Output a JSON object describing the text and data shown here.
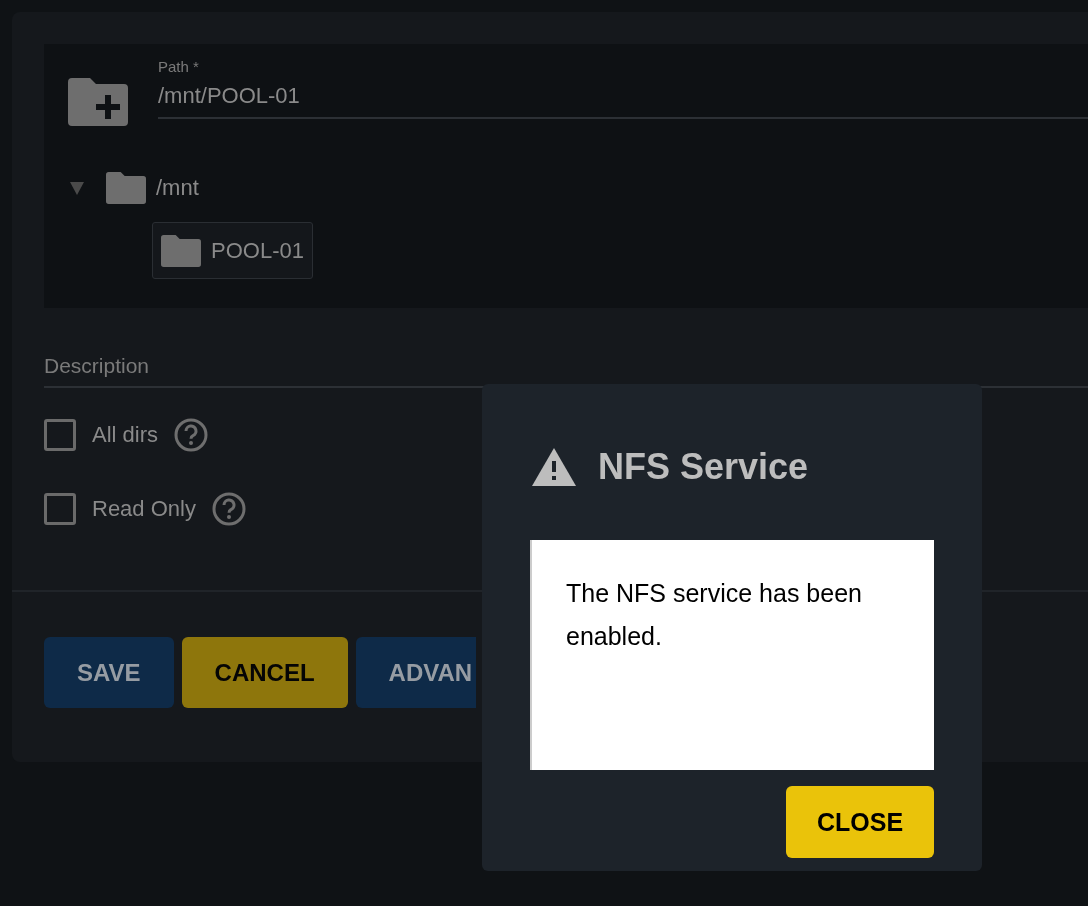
{
  "path_field": {
    "label": "Path *",
    "value": "/mnt/POOL-01"
  },
  "tree": [
    {
      "label": "/mnt",
      "expanded": true,
      "children": [
        {
          "label": "POOL-01",
          "selected": true
        }
      ]
    }
  ],
  "description_field": {
    "placeholder": "Description"
  },
  "checkboxes": [
    {
      "label": "All dirs",
      "checked": false
    },
    {
      "label": "Read Only",
      "checked": false
    }
  ],
  "buttons": [
    {
      "label": "SAVE",
      "kind": "primary"
    },
    {
      "label": "CANCEL",
      "kind": "accent"
    },
    {
      "label": "ADVAN",
      "kind": "primary"
    }
  ],
  "dialog": {
    "title": "NFS Service",
    "message": "The NFS service has been enabled.",
    "button": "CLOSE"
  }
}
